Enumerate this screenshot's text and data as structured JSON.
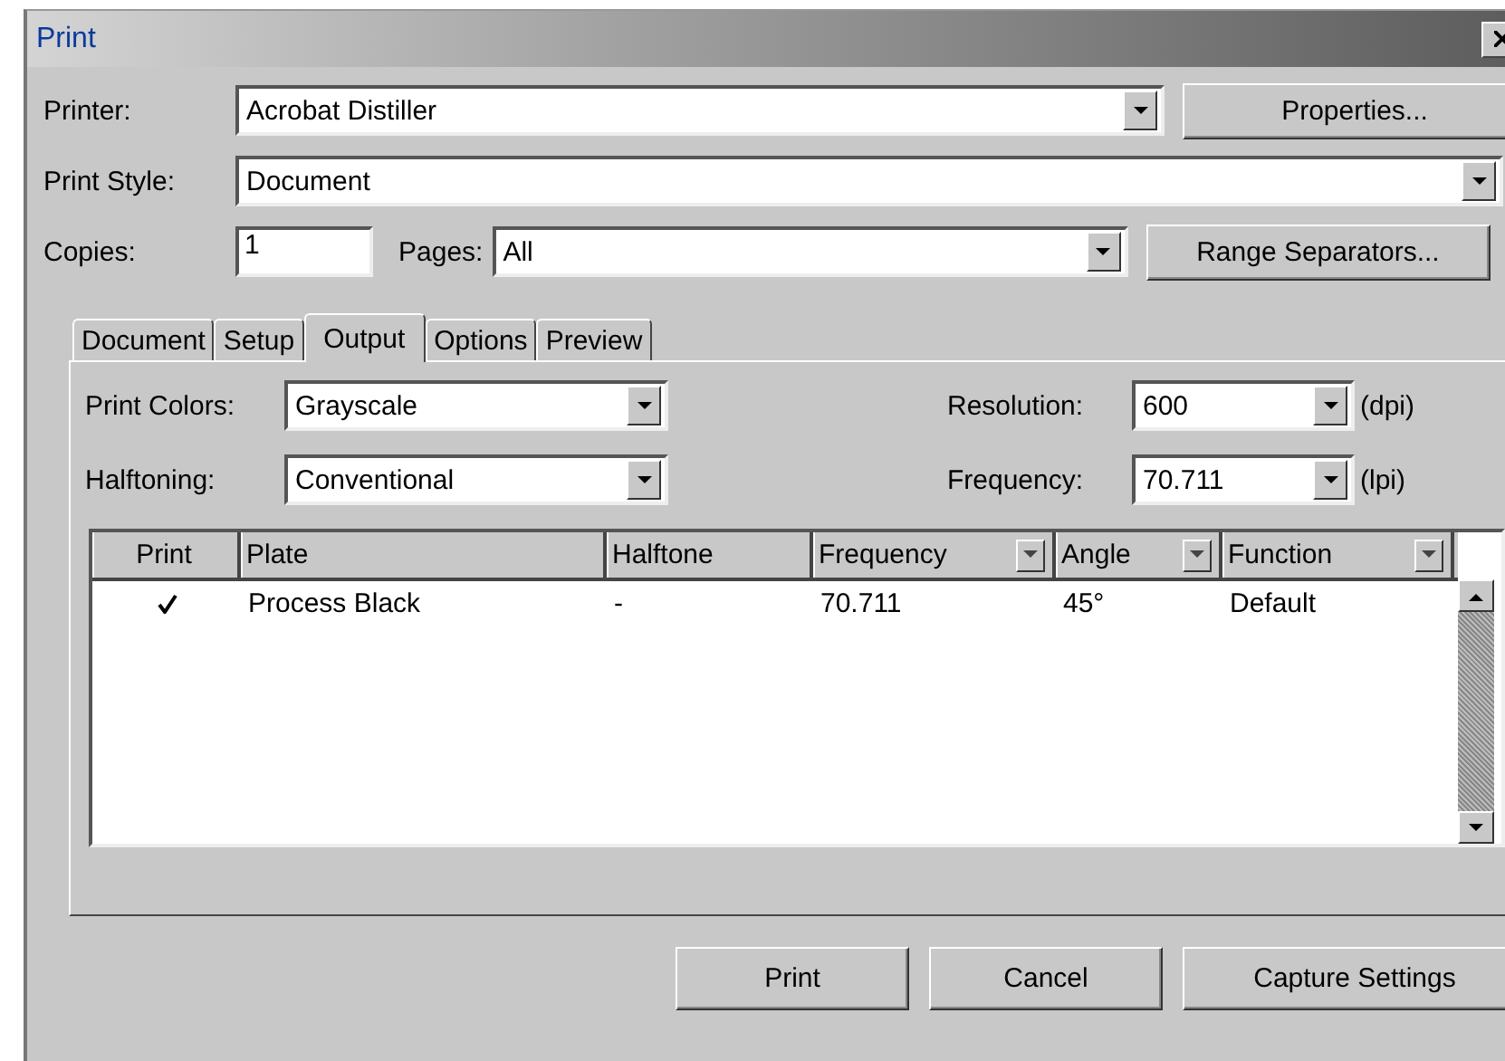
{
  "window": {
    "title": "Print"
  },
  "printer": {
    "label": "Printer:",
    "value": "Acrobat Distiller",
    "button": "Properties..."
  },
  "print_style": {
    "label": "Print Style:",
    "value": "Document"
  },
  "copies": {
    "label": "Copies:",
    "value": "1"
  },
  "pages": {
    "label": "Pages:",
    "value": "All",
    "button": "Range Separators..."
  },
  "tabs": [
    {
      "label": "Document",
      "selected": false
    },
    {
      "label": "Setup",
      "selected": false
    },
    {
      "label": "Output",
      "selected": true
    },
    {
      "label": "Options",
      "selected": false
    },
    {
      "label": "Preview",
      "selected": false
    }
  ],
  "output": {
    "print_colors": {
      "label": "Print Colors:",
      "value": "Grayscale"
    },
    "halftoning": {
      "label": "Halftoning:",
      "value": "Conventional"
    },
    "resolution": {
      "label": "Resolution:",
      "value": "600",
      "unit": "(dpi)"
    },
    "frequency": {
      "label": "Frequency:",
      "value": "70.711",
      "unit": "(lpi)"
    }
  },
  "table": {
    "columns": [
      {
        "label": "Print",
        "has_menu": false
      },
      {
        "label": "Plate",
        "has_menu": false
      },
      {
        "label": "Halftone",
        "has_menu": false
      },
      {
        "label": "Frequency",
        "has_menu": true
      },
      {
        "label": "Angle",
        "has_menu": true
      },
      {
        "label": "Function",
        "has_menu": true
      }
    ],
    "rows": [
      {
        "checked": true,
        "plate": "Process Black",
        "halftone": "-",
        "frequency": "70.711",
        "angle": "45°",
        "function": "Default"
      }
    ]
  },
  "buttons": [
    "Print",
    "Cancel",
    "Capture Settings"
  ]
}
